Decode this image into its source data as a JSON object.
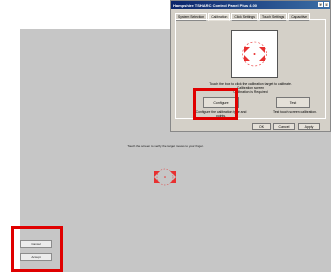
{
  "dialog": {
    "title": "Hampshire TSHARC Control Panel Plus 4.00",
    "tabs": [
      "System Selection",
      "Calibration",
      "Click Settings",
      "Touch Settings",
      "Capacitive"
    ],
    "calibrate_text_1": "Touch the box to click the calibration target to calibrate.",
    "calibrate_text_2": "Calibration screen",
    "calibrate_text_3": "Calibration is Required",
    "configure_label": "Configure",
    "configure_desc": "Configure the calibration type and points.",
    "test_label": "Test",
    "test_desc": "Test touch screen calibration.",
    "ok_label": "OK",
    "cancel_label": "Cancel",
    "apply_label": "Apply"
  },
  "screen": {
    "instruction": "Touch the screen to verify the target moves to your finger.",
    "cancel_label": "Cancel",
    "accept_label": "Accept"
  },
  "colors": {
    "highlight": "#e00000",
    "target": "#e83030",
    "screen_bg": "#c6c6c6"
  }
}
